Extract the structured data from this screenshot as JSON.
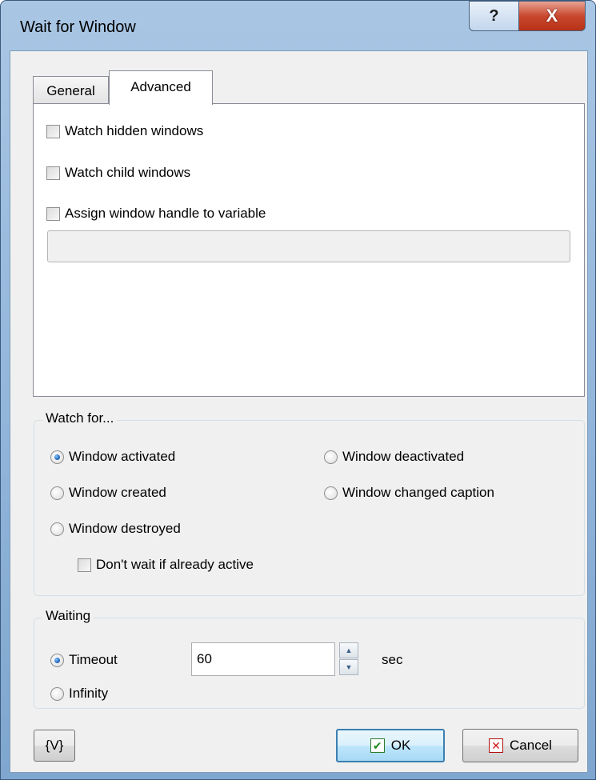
{
  "window": {
    "title": "Wait for Window",
    "help_glyph": "?",
    "close_glyph": "X"
  },
  "tabs": [
    {
      "label": "General",
      "selected": false
    },
    {
      "label": "Advanced",
      "selected": true
    }
  ],
  "advanced": {
    "watch_hidden_label": "Watch hidden windows",
    "watch_hidden_checked": false,
    "watch_child_label": "Watch child windows",
    "watch_child_checked": false,
    "assign_handle_label": "Assign window handle to variable",
    "assign_handle_checked": false,
    "variable_value": ""
  },
  "watch_for": {
    "legend": "Watch for...",
    "options": [
      {
        "label": "Window activated",
        "selected": true
      },
      {
        "label": "Window deactivated",
        "selected": false
      },
      {
        "label": "Window created",
        "selected": false
      },
      {
        "label": "Window changed caption",
        "selected": false
      },
      {
        "label": "Window destroyed",
        "selected": false
      }
    ],
    "dont_wait_label": "Don't wait if already active",
    "dont_wait_checked": false
  },
  "waiting": {
    "legend": "Waiting",
    "timeout_label": "Timeout",
    "timeout_selected": true,
    "timeout_value": "60",
    "unit": "sec",
    "infinity_label": "Infinity",
    "infinity_selected": false
  },
  "buttons": {
    "variables_label": "{V}",
    "ok_label": "OK",
    "cancel_label": "Cancel"
  },
  "icons": [
    "help-icon",
    "close-icon",
    "checkmark-icon",
    "cancel-x-icon",
    "spin-up-icon",
    "spin-down-icon"
  ]
}
